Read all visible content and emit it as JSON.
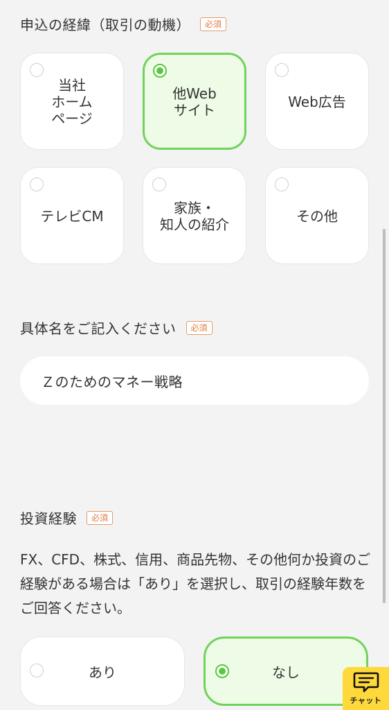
{
  "sections": {
    "motive": {
      "title": "申込の経緯（取引の動機）",
      "badge": "必須"
    },
    "specific": {
      "title": "具体名をご記入ください",
      "badge": "必須"
    },
    "experience": {
      "title": "投資経験",
      "badge": "必須"
    }
  },
  "motive_options": [
    {
      "label": "当社\nホーム\nページ",
      "selected": false
    },
    {
      "label": "他Web\nサイト",
      "selected": true
    },
    {
      "label": "Web広告",
      "selected": false
    },
    {
      "label": "テレビCM",
      "selected": false
    },
    {
      "label": "家族・\n知人の紹介",
      "selected": false
    },
    {
      "label": "その他",
      "selected": false
    }
  ],
  "specific_input": {
    "value": "Ｚのためのマネー戦略"
  },
  "experience_description": "FX、CFD、株式、信用、商品先物、その他何か投資のご経験がある場合は「あり」を選択し、取引の経験年数をご回答ください。",
  "experience_options": [
    {
      "label": "あり",
      "selected": false
    },
    {
      "label": "なし",
      "selected": true
    }
  ],
  "chat_button": {
    "label": "チャット",
    "icon": "chat-bubble-icon"
  },
  "colors": {
    "background": "#f3f3f3",
    "selected_border": "#6fd35a",
    "selected_fill": "#eefbe6",
    "badge": "#e07a40",
    "chat": "#ffd93b"
  }
}
